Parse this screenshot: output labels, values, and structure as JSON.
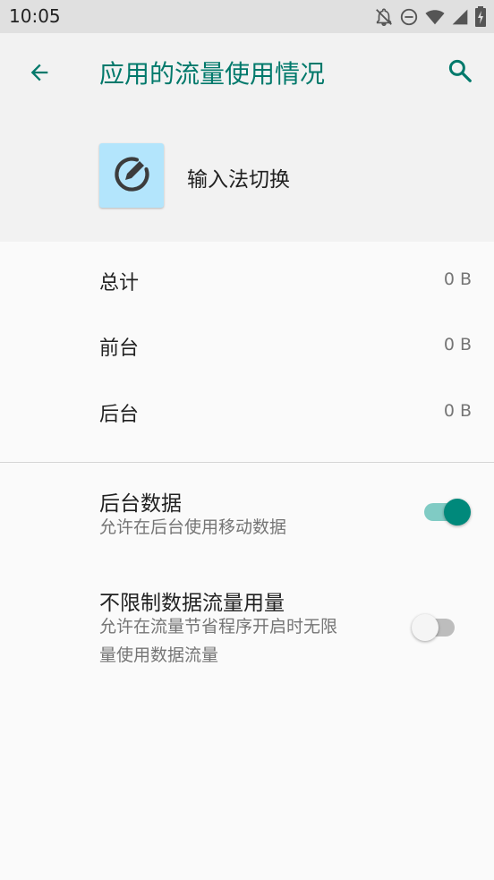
{
  "status_bar": {
    "time": "10:05",
    "icons": [
      "notifications-off-icon",
      "do-not-disturb-icon",
      "wifi-icon",
      "signal-icon",
      "battery-charging-icon"
    ]
  },
  "header": {
    "title": "应用的流量使用情况",
    "back_icon": "arrow-back-icon",
    "search_icon": "search-icon"
  },
  "app": {
    "name": "输入法切换",
    "icon": "edit-pencil-icon"
  },
  "usage": [
    {
      "label": "总计",
      "value": "0 B"
    },
    {
      "label": "前台",
      "value": "0 B"
    },
    {
      "label": "后台",
      "value": "0 B"
    }
  ],
  "preferences": {
    "background_data": {
      "title": "后台数据",
      "summary": "允许在后台使用移动数据",
      "enabled": true
    },
    "unrestricted_data": {
      "title": "不限制数据流量用量",
      "summary_line1": "允许在流量节省程序开启时无限",
      "summary_line2": "量使用数据流量",
      "enabled": false
    }
  },
  "colors": {
    "accent": "#00796b",
    "switch_on_thumb": "#00897b",
    "switch_on_track": "#80cbc4",
    "app_icon_bg": "#b3e5fc"
  }
}
